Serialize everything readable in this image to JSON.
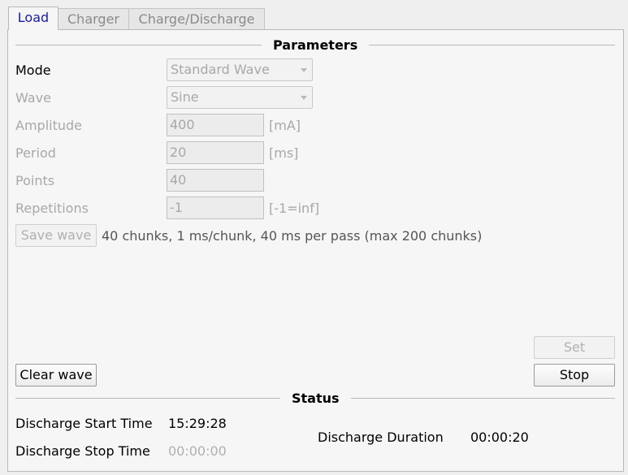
{
  "tabs": [
    {
      "label": "Load",
      "active": true
    },
    {
      "label": "Charger",
      "active": false
    },
    {
      "label": "Charge/Discharge",
      "active": false
    }
  ],
  "parameters": {
    "title": "Parameters",
    "mode_label": "Mode",
    "mode_value": "Standard Wave",
    "wave_label": "Wave",
    "wave_value": "Sine",
    "amplitude_label": "Amplitude",
    "amplitude_value": "400",
    "amplitude_unit": "[mA]",
    "period_label": "Period",
    "period_value": "20",
    "period_unit": "[ms]",
    "points_label": "Points",
    "points_value": "40",
    "repetitions_label": "Repetitions",
    "repetitions_value": "-1",
    "repetitions_unit": "[-1=inf]",
    "save_wave_label": "Save wave",
    "wave_info": "40 chunks, 1 ms/chunk, 40 ms per pass (max 200 chunks)"
  },
  "actions": {
    "set_label": "Set",
    "stop_label": "Stop",
    "clear_wave_label": "Clear wave"
  },
  "status": {
    "title": "Status",
    "discharge_start_label": "Discharge Start Time",
    "discharge_start_value": "15:29:28",
    "discharge_stop_label": "Discharge Stop Time",
    "discharge_stop_value": "00:00:00",
    "discharge_duration_label": "Discharge Duration",
    "discharge_duration_value": "00:00:20"
  },
  "colors": {
    "active_tab_text": "#1a1aa0",
    "disabled_text": "#a8a8a8"
  }
}
